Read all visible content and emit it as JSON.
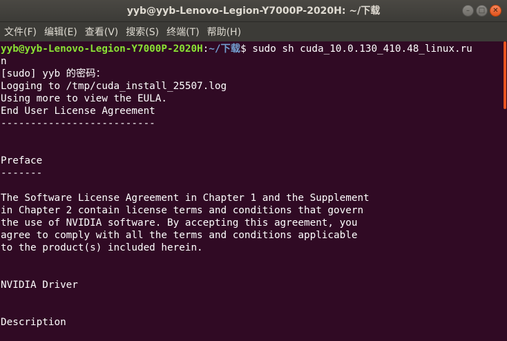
{
  "window": {
    "title": "yyb@yyb-Lenovo-Legion-Y7000P-2020H: ~/下载"
  },
  "menu": [
    {
      "label": "文件(F)"
    },
    {
      "label": "编辑(E)"
    },
    {
      "label": "查看(V)"
    },
    {
      "label": "搜索(S)"
    },
    {
      "label": "终端(T)"
    },
    {
      "label": "帮助(H)"
    }
  ],
  "prompt": {
    "user_host": "yyb@yyb-Lenovo-Legion-Y7000P-2020H",
    "colon": ":",
    "path": "~/下载",
    "symbol": "$",
    "command": " sudo sh cuda_10.0.130_410.48_linux.ru",
    "command_wrap": "n"
  },
  "output": [
    "[sudo] yyb 的密码：",
    "Logging to /tmp/cuda_install_25507.log",
    "Using more to view the EULA.",
    "End User License Agreement",
    "--------------------------",
    "",
    "",
    "Preface",
    "-------",
    "",
    "The Software License Agreement in Chapter 1 and the Supplement",
    "in Chapter 2 contain license terms and conditions that govern",
    "the use of NVIDIA software. By accepting this agreement, you",
    "agree to comply with all the terms and conditions applicable",
    "to the product(s) included herein.",
    "",
    "",
    "NVIDIA Driver",
    "",
    "",
    "Description",
    ""
  ],
  "colors": {
    "background": "#300a24",
    "titlebar": "#3c3b37",
    "prompt_user": "#8ae234",
    "prompt_path": "#729fcf",
    "close_button": "#e95420",
    "scrollbar_thumb": "#e95420"
  },
  "icons": {
    "minimize": "minimize-icon",
    "maximize": "maximize-icon",
    "close": "close-icon"
  }
}
